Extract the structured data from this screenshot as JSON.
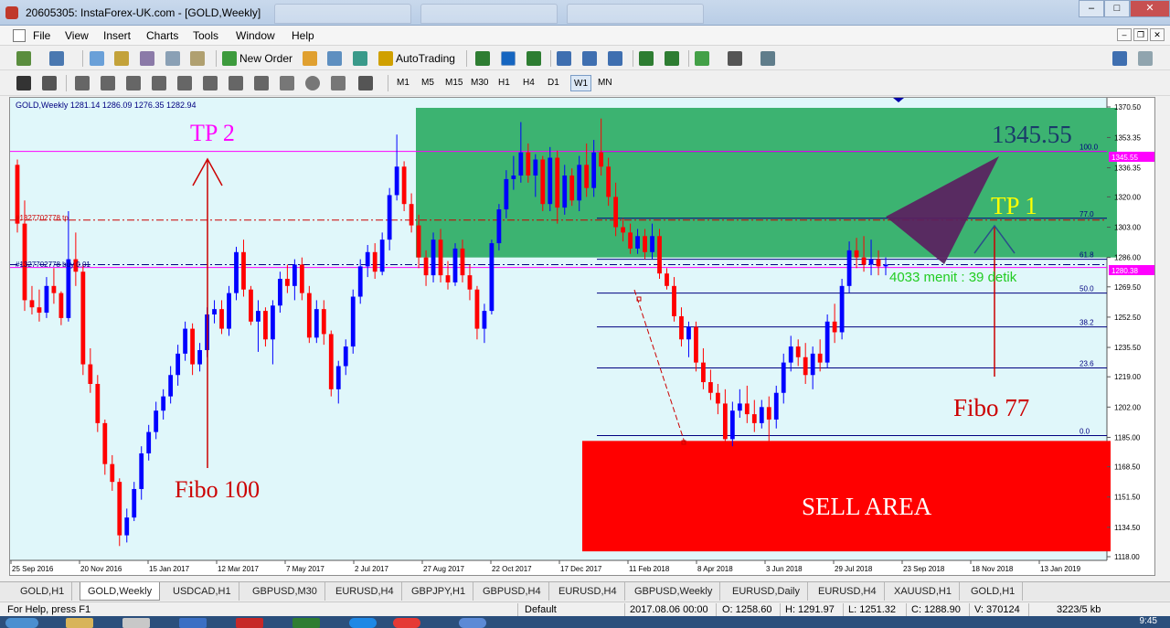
{
  "window": {
    "title": "20605305: InstaForex-UK.com - [GOLD,Weekly]"
  },
  "menu": [
    "File",
    "View",
    "Insert",
    "Charts",
    "Tools",
    "Window",
    "Help"
  ],
  "toolbar": {
    "new_order": "New Order",
    "autotrading": "AutoTrading"
  },
  "timeframes": [
    "M1",
    "M5",
    "M15",
    "M30",
    "H1",
    "H4",
    "D1",
    "W1",
    "MN"
  ],
  "active_timeframe": "W1",
  "chart": {
    "header": "GOLD,Weekly  1281.14 1286.09 1276.35 1282.94",
    "order_tp_label": "#1327702778 tp",
    "order_buy_label": "#1327702778 buy 0.01",
    "current_price": "1280.38",
    "tp_line_price": "1345.55",
    "annotations": {
      "tp2": "TP 2",
      "tp1": "TP 1",
      "price_big": "1345.55",
      "fibo100": "Fibo 100",
      "fibo77": "Fibo 77",
      "sell_area": "SELL AREA",
      "timer": "4033 menit : 39 detik"
    },
    "fib_levels": [
      {
        "label": "100.0",
        "price": 1345.55
      },
      {
        "label": "77.0",
        "price": 1308
      },
      {
        "label": "61.8",
        "price": 1285
      },
      {
        "label": "50.0",
        "price": 1266
      },
      {
        "label": "38.2",
        "price": 1247
      },
      {
        "label": "23.6",
        "price": 1224
      },
      {
        "label": "0.0",
        "price": 1186
      }
    ],
    "price_axis": [
      "1370.50",
      "1353.35",
      "1336.35",
      "1320.00",
      "1303.00",
      "1286.00",
      "1269.50",
      "1252.50",
      "1235.50",
      "1219.00",
      "1202.00",
      "1185.00",
      "1168.50",
      "1151.50",
      "1134.50",
      "1118.00"
    ],
    "time_axis": [
      "25 Sep 2016",
      "20 Nov 2016",
      "15 Jan 2017",
      "12 Mar 2017",
      "7 May 2017",
      "2 Jul 2017",
      "27 Aug 2017",
      "22 Oct 2017",
      "17 Dec 2017",
      "11 Feb 2018",
      "8 Apr 2018",
      "3 Jun 2018",
      "29 Jul 2018",
      "23 Sep 2018",
      "18 Nov 2018",
      "13 Jan 2019"
    ]
  },
  "chart_data": {
    "type": "candlestick",
    "symbol": "GOLD",
    "timeframe": "Weekly",
    "ylim": [
      1118,
      1370.5
    ],
    "grid": false,
    "colors": {
      "bull": "#0000ff",
      "bear": "#ff0000",
      "background": "#e0f7fa"
    },
    "ohlc": [
      [
        1338,
        1341,
        1300,
        1305
      ],
      [
        1305,
        1318,
        1256,
        1262
      ],
      [
        1262,
        1270,
        1254,
        1258
      ],
      [
        1258,
        1268,
        1250,
        1255
      ],
      [
        1255,
        1275,
        1252,
        1270
      ],
      [
        1270,
        1280,
        1260,
        1266
      ],
      [
        1266,
        1267,
        1248,
        1252
      ],
      [
        1252,
        1312,
        1250,
        1285
      ],
      [
        1285,
        1300,
        1270,
        1278
      ],
      [
        1278,
        1282,
        1220,
        1226
      ],
      [
        1226,
        1235,
        1210,
        1215
      ],
      [
        1215,
        1220,
        1188,
        1193
      ],
      [
        1193,
        1195,
        1164,
        1170
      ],
      [
        1170,
        1175,
        1155,
        1160
      ],
      [
        1160,
        1162,
        1124,
        1130
      ],
      [
        1130,
        1145,
        1126,
        1140
      ],
      [
        1140,
        1160,
        1138,
        1156
      ],
      [
        1156,
        1180,
        1150,
        1176
      ],
      [
        1176,
        1192,
        1172,
        1188
      ],
      [
        1188,
        1205,
        1184,
        1200
      ],
      [
        1200,
        1212,
        1195,
        1208
      ],
      [
        1208,
        1225,
        1204,
        1220
      ],
      [
        1220,
        1237,
        1214,
        1232
      ],
      [
        1232,
        1250,
        1228,
        1246
      ],
      [
        1246,
        1249,
        1220,
        1226
      ],
      [
        1226,
        1238,
        1222,
        1234
      ],
      [
        1234,
        1258,
        1230,
        1254
      ],
      [
        1254,
        1262,
        1249,
        1257
      ],
      [
        1257,
        1262,
        1243,
        1246
      ],
      [
        1246,
        1270,
        1242,
        1266
      ],
      [
        1266,
        1292,
        1262,
        1289
      ],
      [
        1289,
        1296,
        1264,
        1268
      ],
      [
        1268,
        1270,
        1248,
        1250
      ],
      [
        1250,
        1262,
        1233,
        1256
      ],
      [
        1256,
        1258,
        1236,
        1240
      ],
      [
        1240,
        1262,
        1226,
        1259
      ],
      [
        1259,
        1278,
        1255,
        1274
      ],
      [
        1274,
        1282,
        1266,
        1270
      ],
      [
        1270,
        1285,
        1262,
        1282
      ],
      [
        1282,
        1286,
        1262,
        1266
      ],
      [
        1266,
        1270,
        1238,
        1241
      ],
      [
        1241,
        1262,
        1238,
        1257
      ],
      [
        1257,
        1262,
        1237,
        1243
      ],
      [
        1243,
        1245,
        1208,
        1212
      ],
      [
        1212,
        1228,
        1204,
        1225
      ],
      [
        1225,
        1240,
        1220,
        1236
      ],
      [
        1236,
        1268,
        1232,
        1264
      ],
      [
        1264,
        1285,
        1260,
        1281
      ],
      [
        1281,
        1293,
        1275,
        1289
      ],
      [
        1289,
        1294,
        1274,
        1278
      ],
      [
        1278,
        1300,
        1276,
        1296
      ],
      [
        1296,
        1325,
        1290,
        1321
      ],
      [
        1321,
        1355,
        1318,
        1337
      ],
      [
        1337,
        1340,
        1312,
        1316
      ],
      [
        1316,
        1322,
        1300,
        1304
      ],
      [
        1304,
        1310,
        1280,
        1286
      ],
      [
        1286,
        1290,
        1270,
        1276
      ],
      [
        1276,
        1300,
        1272,
        1296
      ],
      [
        1296,
        1302,
        1272,
        1276
      ],
      [
        1276,
        1284,
        1268,
        1272
      ],
      [
        1272,
        1294,
        1270,
        1291
      ],
      [
        1291,
        1296,
        1272,
        1276
      ],
      [
        1276,
        1282,
        1262,
        1268
      ],
      [
        1268,
        1270,
        1240,
        1246
      ],
      [
        1246,
        1260,
        1238,
        1256
      ],
      [
        1256,
        1296,
        1254,
        1294
      ],
      [
        1294,
        1316,
        1290,
        1313
      ],
      [
        1313,
        1335,
        1308,
        1330
      ],
      [
        1330,
        1343,
        1324,
        1332
      ],
      [
        1332,
        1362,
        1328,
        1345
      ],
      [
        1345,
        1350,
        1328,
        1332
      ],
      [
        1332,
        1344,
        1320,
        1341
      ],
      [
        1341,
        1343,
        1312,
        1316
      ],
      [
        1316,
        1348,
        1312,
        1342
      ],
      [
        1342,
        1346,
        1305,
        1314
      ],
      [
        1314,
        1338,
        1310,
        1332
      ],
      [
        1332,
        1336,
        1315,
        1318
      ],
      [
        1318,
        1343,
        1312,
        1338
      ],
      [
        1338,
        1350,
        1320,
        1325
      ],
      [
        1325,
        1352,
        1320,
        1345
      ],
      [
        1345,
        1364,
        1332,
        1337
      ],
      [
        1337,
        1342,
        1315,
        1320
      ],
      [
        1320,
        1328,
        1298,
        1303
      ],
      [
        1303,
        1308,
        1295,
        1300
      ],
      [
        1300,
        1305,
        1288,
        1291
      ],
      [
        1291,
        1302,
        1288,
        1298
      ],
      [
        1298,
        1302,
        1285,
        1289
      ],
      [
        1289,
        1305,
        1285,
        1298
      ],
      [
        1298,
        1302,
        1274,
        1277
      ],
      [
        1277,
        1280,
        1268,
        1270
      ],
      [
        1270,
        1275,
        1250,
        1253
      ],
      [
        1253,
        1258,
        1236,
        1240
      ],
      [
        1240,
        1250,
        1230,
        1247
      ],
      [
        1247,
        1250,
        1222,
        1227
      ],
      [
        1227,
        1235,
        1212,
        1216
      ],
      [
        1216,
        1223,
        1206,
        1210
      ],
      [
        1210,
        1215,
        1198,
        1204
      ],
      [
        1204,
        1212,
        1180,
        1184
      ],
      [
        1184,
        1205,
        1180,
        1200
      ],
      [
        1200,
        1212,
        1196,
        1204
      ],
      [
        1204,
        1214,
        1193,
        1198
      ],
      [
        1198,
        1206,
        1188,
        1193
      ],
      [
        1193,
        1206,
        1190,
        1202
      ],
      [
        1202,
        1208,
        1182,
        1195
      ],
      [
        1195,
        1214,
        1190,
        1210
      ],
      [
        1210,
        1232,
        1204,
        1227
      ],
      [
        1227,
        1242,
        1222,
        1236
      ],
      [
        1236,
        1240,
        1225,
        1230
      ],
      [
        1230,
        1238,
        1215,
        1220
      ],
      [
        1220,
        1236,
        1212,
        1232
      ],
      [
        1232,
        1240,
        1222,
        1227
      ],
      [
        1227,
        1254,
        1224,
        1250
      ],
      [
        1250,
        1260,
        1238,
        1244
      ],
      [
        1244,
        1274,
        1240,
        1270
      ],
      [
        1270,
        1295,
        1266,
        1290
      ],
      [
        1290,
        1297,
        1280,
        1286
      ],
      [
        1286,
        1298,
        1278,
        1282
      ],
      [
        1282,
        1296,
        1276,
        1285
      ],
      [
        1285,
        1290,
        1276,
        1281
      ],
      [
        1281,
        1286,
        1276,
        1282
      ]
    ],
    "horizontal_lines": [
      {
        "name": "TP 1345.55",
        "price": 1345.55,
        "color": "#ff00ff"
      },
      {
        "name": "order tp",
        "price": 1307,
        "color": "#cc0000",
        "style": "dash-dot"
      },
      {
        "name": "buy 0.01",
        "price": 1282,
        "color": "#000080",
        "style": "dash-dot"
      },
      {
        "name": "bid",
        "price": 1280.38,
        "color": "#ff00ff"
      }
    ],
    "zones": [
      {
        "name": "green zone",
        "from_price": 1286,
        "to_price": 1370,
        "color": "#3cb371"
      },
      {
        "name": "SELL AREA",
        "from_price": 1121,
        "to_price": 1183,
        "color": "#ff0000"
      }
    ]
  }
}
